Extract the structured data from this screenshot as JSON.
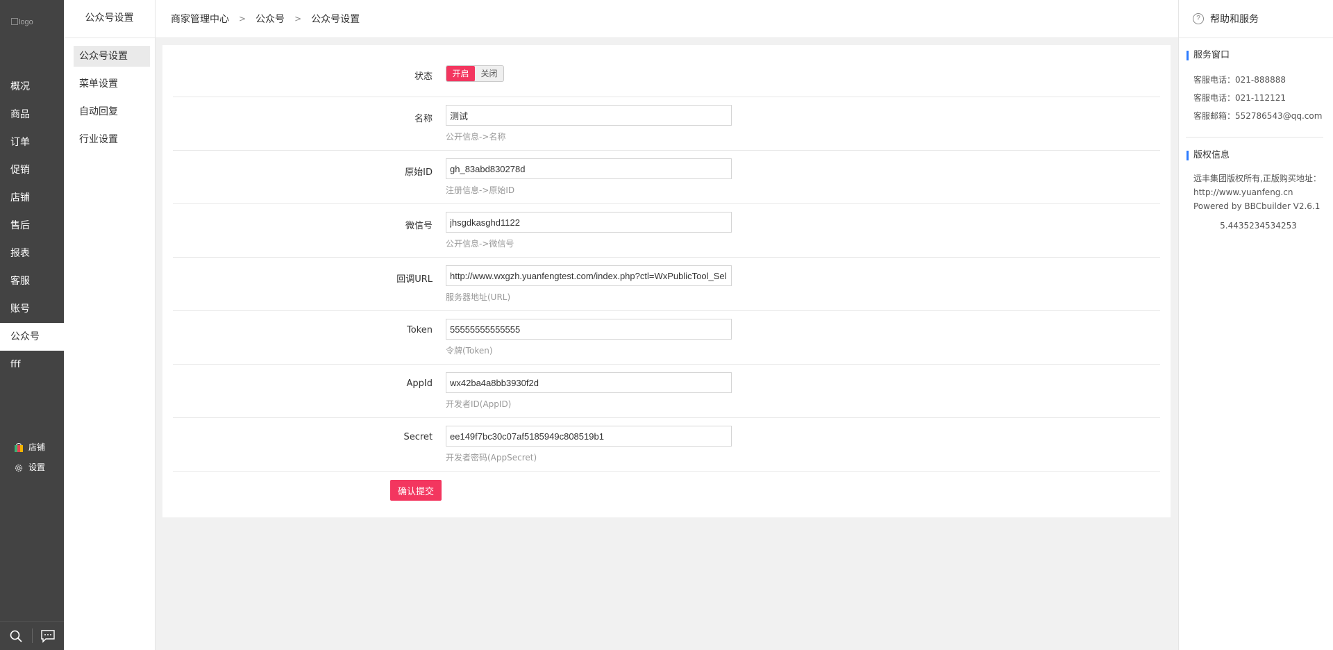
{
  "nav": {
    "logo_alt": "logo",
    "items": [
      "概况",
      "商品",
      "订单",
      "促销",
      "店铺",
      "售后",
      "报表",
      "客服",
      "账号",
      "公众号",
      "fff"
    ],
    "active": "公众号",
    "quick_links": [
      {
        "label": "店铺",
        "icon": "shop-icon"
      },
      {
        "label": "设置",
        "icon": "gear-icon"
      }
    ],
    "bottom_icons": [
      "search-icon",
      "chat-icon"
    ]
  },
  "subnav": {
    "title": "公众号设置",
    "items": [
      "公众号设置",
      "菜单设置",
      "自动回复",
      "行业设置"
    ]
  },
  "breadcrumb": [
    "商家管理中心",
    "公众号",
    "公众号设置"
  ],
  "form": {
    "status": {
      "label": "状态",
      "on": "开启",
      "off": "关闭",
      "value": "开启"
    },
    "name": {
      "label": "名称",
      "value": "测试",
      "hint": "公开信息->名称"
    },
    "original_id": {
      "label": "原始ID",
      "value": "gh_83abd830278d",
      "hint": "注册信息->原始ID"
    },
    "wechat_id": {
      "label": "微信号",
      "value": "jhsgdkasghd1122",
      "hint": "公开信息->微信号"
    },
    "callback_url": {
      "label": "回调URL",
      "value": "http://www.wxgzh.yuanfengtest.com/index.php?ctl=WxPublicTool_Sel",
      "hint": "服务器地址(URL)"
    },
    "token": {
      "label": "Token",
      "value": "55555555555555",
      "hint": "令牌(Token)"
    },
    "appid": {
      "label": "AppId",
      "value": "wx42ba4a8bb3930f2d",
      "hint": "开发者ID(AppID)"
    },
    "secret": {
      "label": "Secret",
      "value": "ee149f7bc30c07af5185949c808519b1",
      "hint": "开发者密码(AppSecret)"
    },
    "submit": "确认提交"
  },
  "right": {
    "title": "帮助和服务",
    "service": {
      "title": "服务窗口",
      "lines": [
        "客服电话：021-888888",
        "客服电话：021-112121",
        "客服邮箱：552786543@qq.com"
      ]
    },
    "copyright": {
      "title": "版权信息",
      "text": "远丰集团版权所有,正版购买地址：http://www.yuanfeng.cn",
      "powered": "Powered by BBCbuilder V2.6.1",
      "number": "5.4435234534253"
    }
  },
  "colors": {
    "accent": "#f3365f",
    "sidebar": "#434343",
    "section_marker": "#2d7bff"
  }
}
